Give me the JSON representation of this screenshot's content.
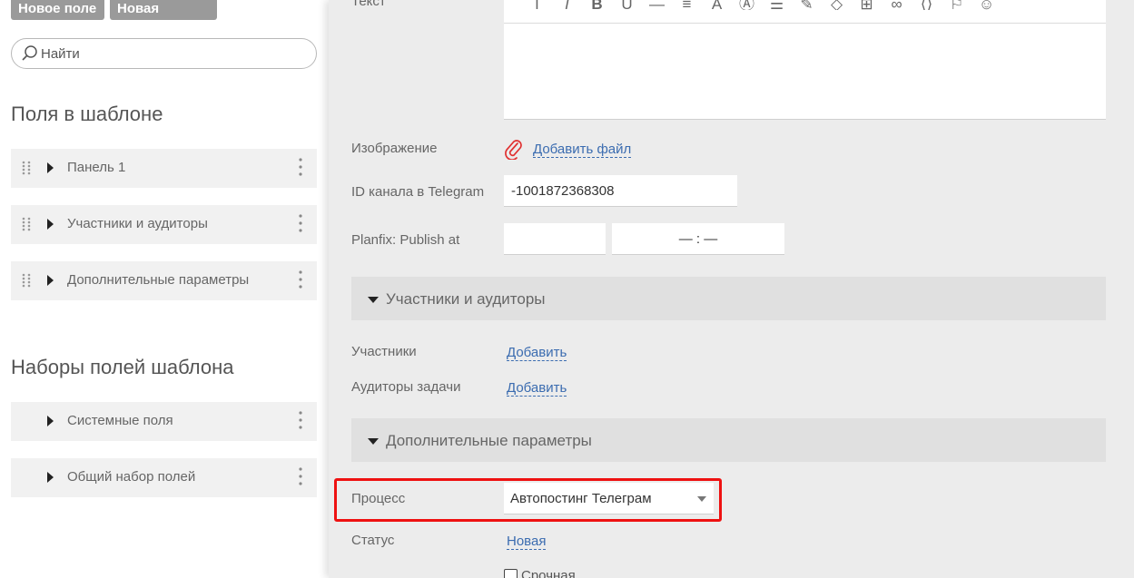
{
  "left_panel": {
    "buttons": {
      "new_field": "Новое поле",
      "new_panel": "Новая панель"
    },
    "search": {
      "placeholder": "Найти"
    },
    "fields_title": "Поля в шаблоне",
    "template_items": [
      {
        "label": "Панель 1"
      },
      {
        "label": "Участники и аудиторы"
      },
      {
        "label": "Дополнительные параметры"
      }
    ],
    "sets_title": "Наборы полей шаблона",
    "set_items": [
      {
        "label": "Системные поля"
      },
      {
        "label": "Общий набор полей"
      }
    ]
  },
  "form": {
    "text_label": "Текст",
    "toolbar_icons": [
      "font-size-icon",
      "italic-icon",
      "bold-icon",
      "underline-icon",
      "strikethrough-icon",
      "align-icon",
      "text-color-icon",
      "highlight-icon",
      "list-icon",
      "format-painter-icon",
      "eraser-icon",
      "table-icon",
      "link-icon",
      "code-icon",
      "bookmark-icon",
      "emoji-icon"
    ],
    "image_label": "Изображение",
    "add_file_link": "Добавить файл",
    "telegram_label": "ID канала в Telegram",
    "telegram_value": "-1001872368308",
    "publish_label": "Planfix: Publish at",
    "publish_date_value": "",
    "publish_time_value": "— : —",
    "participants_panel_title": "Участники и аудиторы",
    "participants_label": "Участники",
    "participants_add": "Добавить",
    "auditors_label": "Аудиторы задачи",
    "auditors_add": "Добавить",
    "extra_panel_title": "Дополнительные параметры",
    "process_label": "Процесс",
    "process_value": "Автопостинг Телеграм",
    "status_label": "Статус",
    "status_value": "Новая",
    "urgent_label": "Срочная"
  },
  "colors": {
    "highlight_border": "#ee1111",
    "link": "#3b6cb0",
    "panel_bg": "#ececec",
    "button_bg": "#9a9a9a"
  }
}
